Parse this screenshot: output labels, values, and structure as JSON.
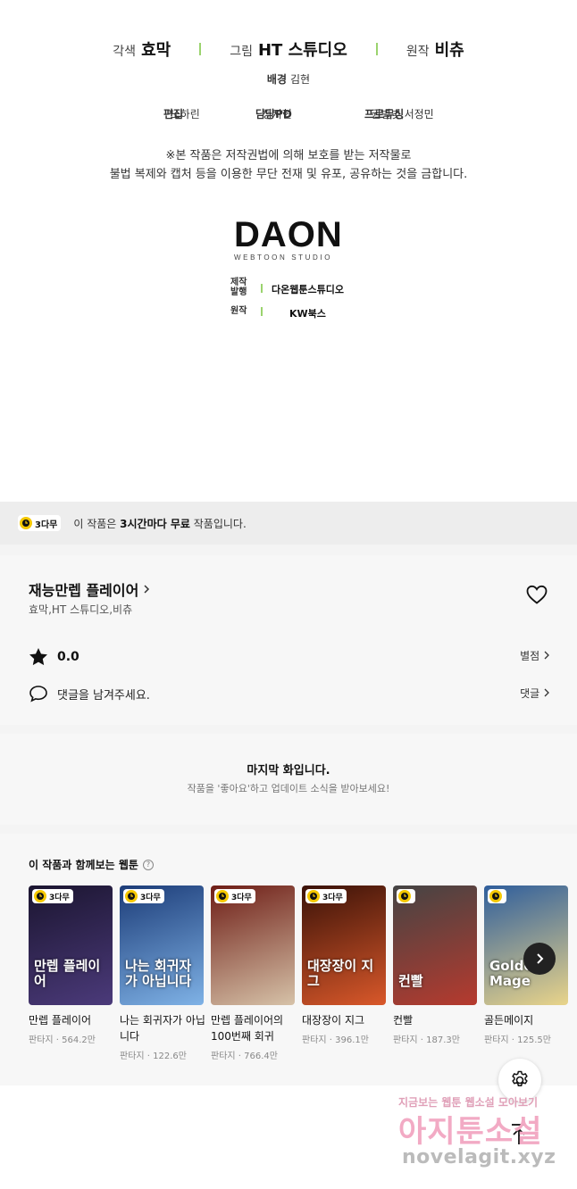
{
  "credits": {
    "roles": [
      {
        "role": "각색",
        "name": "효막"
      },
      {
        "role": "그림",
        "name": "HT 스튜디오"
      },
      {
        "role": "원작",
        "name": "비츄"
      }
    ],
    "background": {
      "role": "배경",
      "name": "김현"
    },
    "staff": [
      {
        "role": "편집",
        "name": "노하린"
      },
      {
        "role": "담당PD",
        "name": "정지현"
      },
      {
        "role": "프로듀싱",
        "name": "권별빛,서정민"
      }
    ],
    "notice_line1": "※본 작품은 저작권법에 의해 보호를 받는 저작물로",
    "notice_line2": "불법 복제와 캡처 등을 이용한 무단 전재 및 유포, 공유하는 것을 금합니다.",
    "logo_main": "DAON",
    "logo_sub": "WEBTOON STUDIO",
    "publishing": [
      {
        "key": "제작 발행",
        "value": "다온웹툰스튜디오"
      },
      {
        "key": "원작",
        "value": "KW북스"
      }
    ]
  },
  "free_banner": {
    "badge": "3다무",
    "text_prefix": "이 작품은 ",
    "text_bold": "3시간마다 무료",
    "text_suffix": " 작품입니다."
  },
  "work": {
    "title": "재능만렙 플레이어",
    "authors": "효막,HT 스튜디오,비츄",
    "rating": "0.0",
    "rating_link": "별점",
    "comment_prompt": "댓글을 남겨주세요.",
    "comment_link": "댓글"
  },
  "last_episode": {
    "title": "마지막 화입니다.",
    "subtitle": "작품을 '좋아요'하고 업데이트 소식을 받아보세요!"
  },
  "recommendations": {
    "heading": "이 작품과 함께보는 웹툰",
    "help": "?",
    "items": [
      {
        "title": "만렙 플레이어",
        "genre": "판타지",
        "views": "564.2만",
        "badge": "3다무",
        "cover_text": "만렙 플레이어",
        "colors": [
          "#1b1530",
          "#4b3a7a"
        ]
      },
      {
        "title": "나는 회귀자가 아닙니다",
        "genre": "판타지",
        "views": "122.6만",
        "badge": "3다무",
        "cover_text": "나는 회귀자가 아닙니다",
        "colors": [
          "#1c3c78",
          "#7fb2e6"
        ]
      },
      {
        "title": "만렙 플레이어의 100번째 회귀",
        "genre": "판타지",
        "views": "766.4만",
        "badge": "3다무",
        "cover_text": "",
        "colors": [
          "#6e1d16",
          "#d6c2a8"
        ]
      },
      {
        "title": "대장장이 지그",
        "genre": "판타지",
        "views": "396.1만",
        "badge": "3다무",
        "cover_text": "대장장이 지그",
        "colors": [
          "#3a1208",
          "#d9582a"
        ]
      },
      {
        "title": "컨빨",
        "genre": "판타지",
        "views": "187.3만",
        "badge": "",
        "cover_text": "컨빨",
        "colors": [
          "#444444",
          "#b63a2e"
        ]
      },
      {
        "title": "골든메이지",
        "genre": "판타지",
        "views": "125.5만",
        "badge": "",
        "cover_text": "Golden Mage",
        "colors": [
          "#2f5e9c",
          "#e9d48a"
        ]
      }
    ]
  },
  "watermark": {
    "small": "지금보는 웹툰 웹소설 모아보기",
    "big": "아지툰소설",
    "url": "novelagit.xyz"
  },
  "icons": {
    "heart": "heart-outline-icon",
    "star": "star-icon",
    "comment": "speech-bubble-icon",
    "settings": "gear-icon",
    "scroll_top": "arrow-up-icon",
    "next": "chevron-right-icon"
  },
  "colors": {
    "accent_bar": "#9bd36e",
    "badge_clock": "#f5c800",
    "banner_bg": "#ededed",
    "section_bg": "#f7f7f7"
  }
}
